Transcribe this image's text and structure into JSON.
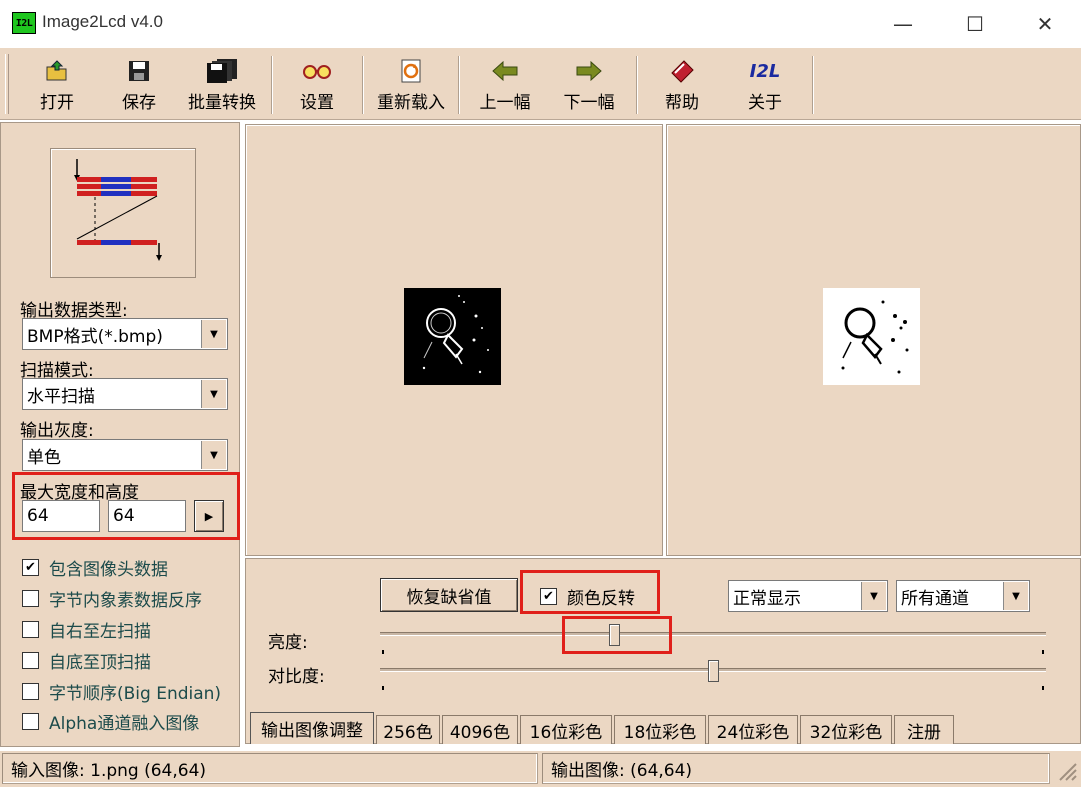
{
  "window": {
    "title": "Image2Lcd v4.0",
    "icon_text": "I2L",
    "minimize_glyph": "—",
    "maximize_glyph": "☐",
    "close_glyph": "✕"
  },
  "toolbar": {
    "open": "打开",
    "save": "保存",
    "batch": "批量转换",
    "settings": "设置",
    "reload": "重新载入",
    "prev": "上一幅",
    "next": "下一幅",
    "help": "帮助",
    "about": "关于",
    "about_icon_text": "I2L"
  },
  "left": {
    "output_type_label": "输出数据类型:",
    "output_type_value": "BMP格式(*.bmp)",
    "scan_mode_label": "扫描模式:",
    "scan_mode_value": "水平扫描",
    "gray_label": "输出灰度:",
    "gray_value": "单色",
    "max_size_label": "最大宽度和高度",
    "max_width": "64",
    "max_height": "64",
    "apply_glyph": "▶",
    "checkboxes": [
      {
        "label": "包含图像头数据",
        "checked": true
      },
      {
        "label": "字节内象素数据反序",
        "checked": false
      },
      {
        "label": "自右至左扫描",
        "checked": false
      },
      {
        "label": "自底至顶扫描",
        "checked": false
      },
      {
        "label": "字节顺序(Big Endian)",
        "checked": false
      },
      {
        "label": "Alpha通道融入图像",
        "checked": false
      }
    ]
  },
  "controls": {
    "restore_default": "恢复缺省值",
    "invert_color_label": "颜色反转",
    "invert_color_checked": true,
    "display_mode": "正常显示",
    "channel": "所有通道",
    "brightness_label": "亮度:",
    "contrast_label": "对比度:",
    "brightness_value": 0.35,
    "contrast_value": 0.5
  },
  "tabs": [
    {
      "label": "输出图像调整",
      "active": true
    },
    {
      "label": "256色",
      "active": false
    },
    {
      "label": "4096色",
      "active": false
    },
    {
      "label": "16位彩色",
      "active": false
    },
    {
      "label": "18位彩色",
      "active": false
    },
    {
      "label": "24位彩色",
      "active": false
    },
    {
      "label": "32位彩色",
      "active": false
    },
    {
      "label": "注册",
      "active": false
    }
  ],
  "status": {
    "input": "输入图像: 1.png (64,64)",
    "output": "输出图像: (64,64)"
  },
  "colors": {
    "panel_bg": "#ebd7c3",
    "highlight": "#e0201a",
    "app_icon": "#1fc61f"
  }
}
